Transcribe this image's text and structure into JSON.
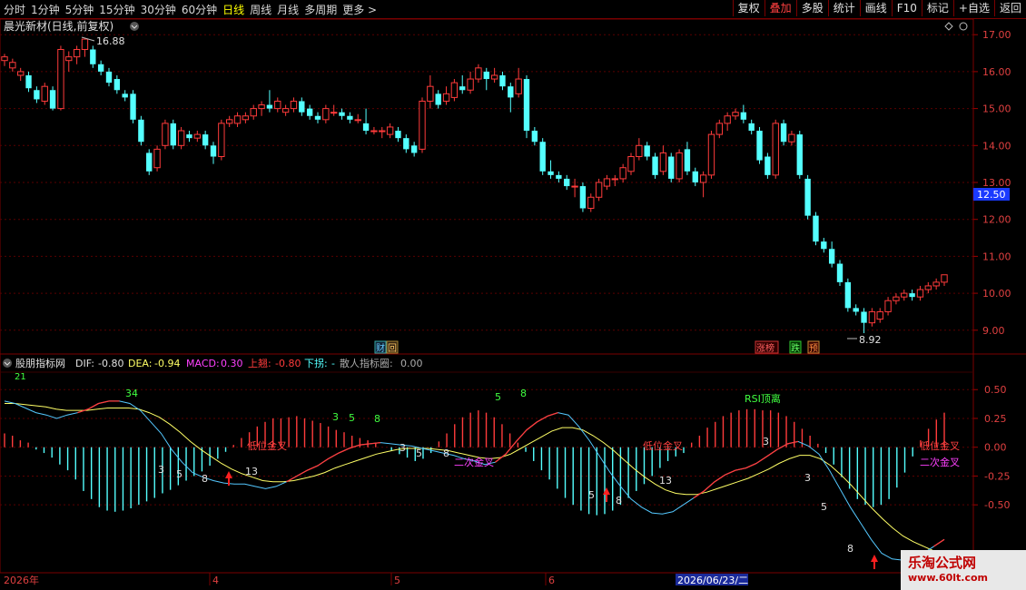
{
  "toolbar": {
    "periods": [
      "分时",
      "1分钟",
      "5分钟",
      "15分钟",
      "30分钟",
      "60分钟",
      "日线",
      "周线",
      "月线",
      "多周期",
      "更多 >"
    ],
    "active_period": "日线",
    "buttons": [
      "复权",
      "叠加",
      "多股",
      "统计",
      "画线",
      "F10",
      "标记",
      "+自选",
      "返回"
    ],
    "active_button": "叠加"
  },
  "main_panel": {
    "title": "晨光新材(日线,前复权)",
    "price_axis": [
      "17.00",
      "16.00",
      "15.00",
      "14.00",
      "13.00",
      "12.00",
      "11.00",
      "10.00",
      "9.00"
    ],
    "current_price": "12.50",
    "high_label": "16.88",
    "low_label": "8.92",
    "event_badges": [
      "财",
      "回"
    ],
    "status_badges": [
      "涨榜",
      "跌",
      "预"
    ]
  },
  "indicator_panel": {
    "name": "股朋指标网",
    "dif_label": "DIF:",
    "dif_value": "-0.80",
    "dea_label": "DEA:",
    "dea_value": "-0.94",
    "macd_label": "MACD:",
    "macd_value": "0.30",
    "up_label": "上翘:",
    "up_value": "-0.80",
    "down_label": "下拐:",
    "down_value": "-",
    "retail_label": "散人指标圈:",
    "retail_value": "0.00",
    "axis": [
      "0.50",
      "0.25",
      "0.00",
      "-0.25",
      "-0.50"
    ],
    "annotations": {
      "low_golden_cross": "低位金叉",
      "second_golden_cross": "二次金叉",
      "rsi_divergence": "RSI顶离"
    },
    "counts": [
      "21",
      "34",
      "3",
      "5",
      "8",
      "13",
      "3",
      "5",
      "8",
      "3",
      "5",
      "8",
      "5",
      "8",
      "5",
      "8",
      "13",
      "3",
      "3",
      "5",
      "8"
    ]
  },
  "date_axis": {
    "year_label": "2026年",
    "months": [
      "4",
      "5",
      "6"
    ],
    "cursor_date": "2026/06/23/二"
  },
  "watermark": {
    "line1": "乐淘公式网",
    "line2": "www.60lt.com"
  },
  "colors": {
    "up": "#ff3b3b",
    "down": "#54ffff",
    "dif": "#54c8ff",
    "dea": "#ffff66",
    "grid": "#7a0000",
    "axis_text": "#e04040"
  },
  "chart_data": {
    "type": "candlestick",
    "ylim": [
      8.7,
      17.3
    ],
    "candles": [
      [
        16.3,
        16.4,
        16.15,
        16.48
      ],
      [
        16.1,
        16.25,
        16.0,
        16.35
      ],
      [
        15.9,
        16.0,
        15.75,
        16.1
      ],
      [
        15.9,
        15.55,
        15.45,
        16.0
      ],
      [
        15.5,
        15.25,
        15.15,
        15.6
      ],
      [
        15.2,
        15.6,
        15.1,
        15.7
      ],
      [
        15.5,
        15.0,
        14.95,
        15.6
      ],
      [
        15.0,
        16.6,
        14.95,
        16.7
      ],
      [
        16.3,
        16.4,
        16.0,
        16.55
      ],
      [
        16.4,
        16.6,
        16.2,
        16.7
      ],
      [
        16.6,
        16.88,
        16.4,
        16.88
      ],
      [
        16.6,
        16.2,
        16.1,
        16.7
      ],
      [
        16.2,
        16.0,
        15.9,
        16.3
      ],
      [
        16.0,
        15.7,
        15.6,
        16.1
      ],
      [
        15.8,
        15.5,
        15.4,
        15.9
      ],
      [
        15.4,
        15.3,
        15.2,
        15.5
      ],
      [
        15.4,
        14.7,
        14.6,
        15.5
      ],
      [
        14.7,
        14.1,
        14.0,
        14.8
      ],
      [
        13.8,
        13.3,
        13.2,
        13.9
      ],
      [
        13.4,
        13.9,
        13.3,
        14.0
      ],
      [
        14.0,
        14.6,
        13.9,
        14.7
      ],
      [
        14.6,
        14.0,
        13.9,
        14.7
      ],
      [
        14.0,
        14.4,
        13.9,
        14.5
      ],
      [
        14.3,
        14.2,
        14.1,
        14.4
      ],
      [
        14.2,
        14.3,
        14.1,
        14.4
      ],
      [
        14.3,
        14.0,
        13.9,
        14.4
      ],
      [
        14.0,
        13.7,
        13.5,
        14.1
      ],
      [
        13.7,
        14.6,
        13.6,
        14.7
      ],
      [
        14.6,
        14.7,
        14.5,
        14.8
      ],
      [
        14.6,
        14.8,
        14.5,
        14.9
      ],
      [
        14.7,
        14.8,
        14.6,
        14.9
      ],
      [
        14.8,
        15.0,
        14.7,
        15.1
      ],
      [
        15.0,
        15.1,
        14.8,
        15.2
      ],
      [
        15.1,
        15.0,
        14.9,
        15.5
      ],
      [
        15.0,
        15.2,
        14.9,
        15.3
      ],
      [
        14.9,
        15.0,
        14.8,
        15.1
      ],
      [
        15.0,
        15.2,
        14.9,
        15.3
      ],
      [
        15.2,
        14.9,
        14.8,
        15.3
      ],
      [
        15.0,
        14.8,
        14.7,
        15.1
      ],
      [
        14.8,
        14.7,
        14.6,
        14.9
      ],
      [
        14.7,
        15.0,
        14.6,
        15.1
      ],
      [
        14.9,
        14.9,
        14.8,
        15.1
      ],
      [
        14.9,
        14.8,
        14.7,
        15.0
      ],
      [
        14.8,
        14.7,
        14.6,
        14.9
      ],
      [
        14.7,
        14.7,
        14.6,
        14.85
      ],
      [
        14.6,
        14.4,
        14.3,
        15.0
      ],
      [
        14.4,
        14.4,
        14.3,
        14.5
      ],
      [
        14.4,
        14.4,
        14.2,
        14.5
      ],
      [
        14.3,
        14.5,
        14.2,
        14.6
      ],
      [
        14.4,
        14.2,
        14.1,
        14.5
      ],
      [
        14.2,
        13.9,
        13.8,
        14.3
      ],
      [
        14.0,
        13.8,
        13.7,
        14.1
      ],
      [
        13.9,
        15.2,
        13.8,
        15.3
      ],
      [
        15.2,
        15.6,
        15.0,
        15.9
      ],
      [
        15.4,
        15.1,
        15.0,
        15.5
      ],
      [
        15.2,
        15.4,
        15.1,
        15.6
      ],
      [
        15.3,
        15.7,
        15.2,
        15.8
      ],
      [
        15.6,
        15.5,
        15.4,
        15.9
      ],
      [
        15.5,
        15.8,
        15.4,
        16.0
      ],
      [
        15.8,
        16.1,
        15.7,
        16.2
      ],
      [
        16.0,
        15.8,
        15.5,
        16.1
      ],
      [
        15.8,
        15.9,
        15.7,
        16.1
      ],
      [
        15.9,
        15.6,
        15.5,
        16.0
      ],
      [
        15.6,
        15.3,
        14.9,
        15.7
      ],
      [
        15.4,
        15.8,
        15.3,
        16.1
      ],
      [
        15.8,
        14.4,
        14.2,
        15.9
      ],
      [
        14.4,
        14.1,
        14.0,
        14.5
      ],
      [
        14.1,
        13.3,
        13.2,
        14.2
      ],
      [
        13.3,
        13.2,
        13.1,
        13.6
      ],
      [
        13.2,
        13.1,
        13.0,
        13.3
      ],
      [
        13.1,
        12.9,
        12.8,
        13.2
      ],
      [
        12.9,
        12.9,
        12.6,
        13.1
      ],
      [
        12.9,
        12.3,
        12.2,
        13.0
      ],
      [
        12.3,
        12.6,
        12.2,
        12.7
      ],
      [
        12.6,
        13.0,
        12.5,
        13.1
      ],
      [
        12.9,
        13.1,
        12.8,
        13.2
      ],
      [
        13.1,
        13.1,
        12.9,
        13.2
      ],
      [
        13.1,
        13.4,
        13.0,
        13.5
      ],
      [
        13.3,
        13.7,
        13.2,
        13.8
      ],
      [
        13.7,
        14.0,
        13.6,
        14.2
      ],
      [
        14.0,
        13.7,
        13.6,
        14.1
      ],
      [
        13.7,
        13.2,
        13.1,
        13.8
      ],
      [
        13.3,
        13.8,
        13.2,
        14.0
      ],
      [
        13.7,
        13.1,
        13.0,
        13.8
      ],
      [
        13.1,
        13.8,
        13.0,
        13.9
      ],
      [
        13.9,
        13.3,
        13.2,
        14.1
      ],
      [
        13.3,
        13.0,
        12.9,
        13.4
      ],
      [
        13.0,
        13.2,
        12.6,
        13.3
      ],
      [
        13.2,
        14.3,
        13.1,
        14.4
      ],
      [
        14.3,
        14.6,
        14.2,
        14.7
      ],
      [
        14.6,
        14.8,
        14.4,
        14.9
      ],
      [
        14.8,
        14.9,
        14.7,
        15.0
      ],
      [
        14.9,
        14.7,
        14.6,
        15.1
      ],
      [
        14.6,
        14.4,
        14.3,
        14.7
      ],
      [
        14.4,
        13.6,
        13.5,
        14.5
      ],
      [
        13.7,
        13.2,
        13.1,
        13.8
      ],
      [
        13.2,
        14.6,
        13.1,
        14.7
      ],
      [
        14.6,
        14.1,
        14.0,
        14.7
      ],
      [
        14.1,
        14.3,
        14.0,
        14.4
      ],
      [
        14.3,
        13.2,
        13.1,
        14.4
      ],
      [
        13.1,
        12.1,
        12.0,
        13.2
      ],
      [
        12.1,
        11.4,
        11.3,
        12.2
      ],
      [
        11.4,
        11.2,
        11.1,
        11.5
      ],
      [
        11.2,
        10.8,
        10.7,
        11.4
      ],
      [
        10.8,
        10.3,
        10.2,
        10.9
      ],
      [
        10.3,
        9.6,
        9.5,
        10.4
      ],
      [
        9.6,
        9.5,
        9.4,
        9.7
      ],
      [
        9.5,
        9.2,
        8.92,
        9.6
      ],
      [
        9.2,
        9.5,
        9.1,
        9.6
      ],
      [
        9.3,
        9.5,
        9.2,
        9.6
      ],
      [
        9.5,
        9.8,
        9.4,
        9.9
      ],
      [
        9.8,
        9.9,
        9.7,
        10.0
      ],
      [
        9.9,
        10.0,
        9.8,
        10.1
      ],
      [
        10.0,
        9.9,
        9.8,
        10.1
      ],
      [
        9.9,
        10.1,
        9.8,
        10.2
      ],
      [
        10.1,
        10.2,
        10.0,
        10.3
      ],
      [
        10.2,
        10.3,
        10.1,
        10.4
      ],
      [
        10.3,
        10.5,
        10.2,
        10.5
      ]
    ],
    "macd": {
      "ylim": [
        -1.05,
        0.62
      ],
      "dif": [
        0.4,
        0.38,
        0.34,
        0.3,
        0.28,
        0.25,
        0.28,
        0.3,
        0.33,
        0.38,
        0.4,
        0.4,
        0.38,
        0.32,
        0.22,
        0.12,
        -0.02,
        -0.13,
        -0.22,
        -0.26,
        -0.29,
        -0.31,
        -0.32,
        -0.32,
        -0.34,
        -0.36,
        -0.34,
        -0.3,
        -0.25,
        -0.2,
        -0.16,
        -0.1,
        -0.05,
        -0.01,
        0.02,
        0.03,
        0.04,
        0.03,
        0.02,
        0.01,
        -0.01,
        -0.03,
        -0.05,
        -0.07,
        -0.1,
        -0.12,
        -0.15,
        -0.13,
        -0.06,
        0.05,
        0.15,
        0.22,
        0.27,
        0.3,
        0.28,
        0.18,
        0.06,
        -0.08,
        -0.22,
        -0.34,
        -0.45,
        -0.52,
        -0.57,
        -0.58,
        -0.56,
        -0.5,
        -0.44,
        -0.38,
        -0.3,
        -0.24,
        -0.2,
        -0.18,
        -0.14,
        -0.08,
        -0.02,
        0.03,
        0.05,
        0.01,
        -0.06,
        -0.2,
        -0.36,
        -0.52,
        -0.66,
        -0.8,
        -0.92,
        -0.97,
        -0.98,
        -0.96,
        -0.92,
        -0.86,
        -0.8
      ],
      "dea": [
        0.38,
        0.38,
        0.37,
        0.36,
        0.35,
        0.33,
        0.32,
        0.32,
        0.32,
        0.33,
        0.34,
        0.34,
        0.34,
        0.33,
        0.3,
        0.26,
        0.2,
        0.13,
        0.05,
        -0.02,
        -0.08,
        -0.14,
        -0.19,
        -0.23,
        -0.26,
        -0.29,
        -0.3,
        -0.3,
        -0.29,
        -0.27,
        -0.25,
        -0.22,
        -0.18,
        -0.15,
        -0.12,
        -0.09,
        -0.06,
        -0.04,
        -0.02,
        -0.01,
        -0.01,
        -0.01,
        -0.02,
        -0.03,
        -0.05,
        -0.07,
        -0.09,
        -0.1,
        -0.09,
        -0.06,
        -0.01,
        0.04,
        0.09,
        0.14,
        0.17,
        0.17,
        0.15,
        0.1,
        0.04,
        -0.03,
        -0.11,
        -0.19,
        -0.26,
        -0.32,
        -0.37,
        -0.4,
        -0.41,
        -0.41,
        -0.39,
        -0.36,
        -0.33,
        -0.3,
        -0.27,
        -0.23,
        -0.19,
        -0.14,
        -0.1,
        -0.07,
        -0.07,
        -0.1,
        -0.16,
        -0.24,
        -0.33,
        -0.43,
        -0.53,
        -0.62,
        -0.7,
        -0.77,
        -0.82,
        -0.86,
        -0.9,
        -0.94
      ],
      "hist": [
        0.12,
        0.1,
        0.06,
        0.04,
        -0.02,
        -0.05,
        -0.09,
        -0.15,
        -0.2,
        -0.28,
        -0.38,
        -0.45,
        -0.52,
        -0.55,
        -0.56,
        -0.55,
        -0.53,
        -0.5,
        -0.47,
        -0.44,
        -0.4,
        -0.37,
        -0.33,
        -0.29,
        -0.25,
        -0.21,
        -0.16,
        -0.1,
        -0.04,
        0.02,
        0.08,
        0.13,
        0.18,
        0.22,
        0.25,
        0.25,
        0.26,
        0.27,
        0.25,
        0.23,
        0.21,
        0.18,
        0.15,
        0.13,
        0.1,
        0.08,
        0.06,
        0.04,
        0.0,
        -0.03,
        -0.06,
        -0.09,
        -0.12,
        -0.1,
        -0.05,
        0.05,
        0.12,
        0.2,
        0.26,
        0.3,
        0.32,
        0.3,
        0.26,
        0.2,
        0.12,
        0.04,
        -0.04,
        -0.12,
        -0.2,
        -0.28,
        -0.36,
        -0.44,
        -0.5,
        -0.55,
        -0.58,
        -0.59,
        -0.58,
        -0.55,
        -0.5,
        -0.44,
        -0.38,
        -0.32,
        -0.25,
        -0.18,
        -0.12,
        -0.08,
        -0.05,
        0.04,
        0.1,
        0.17,
        0.22,
        0.27,
        0.3,
        0.32,
        0.33,
        0.33,
        0.32,
        0.32,
        0.3,
        0.27,
        0.22,
        0.16,
        0.1,
        0.03,
        -0.05,
        -0.15,
        -0.26,
        -0.36,
        -0.45,
        -0.5,
        -0.52,
        -0.5,
        -0.45,
        -0.35,
        -0.22,
        -0.08,
        0.06,
        0.16,
        0.24,
        0.3
      ]
    }
  }
}
